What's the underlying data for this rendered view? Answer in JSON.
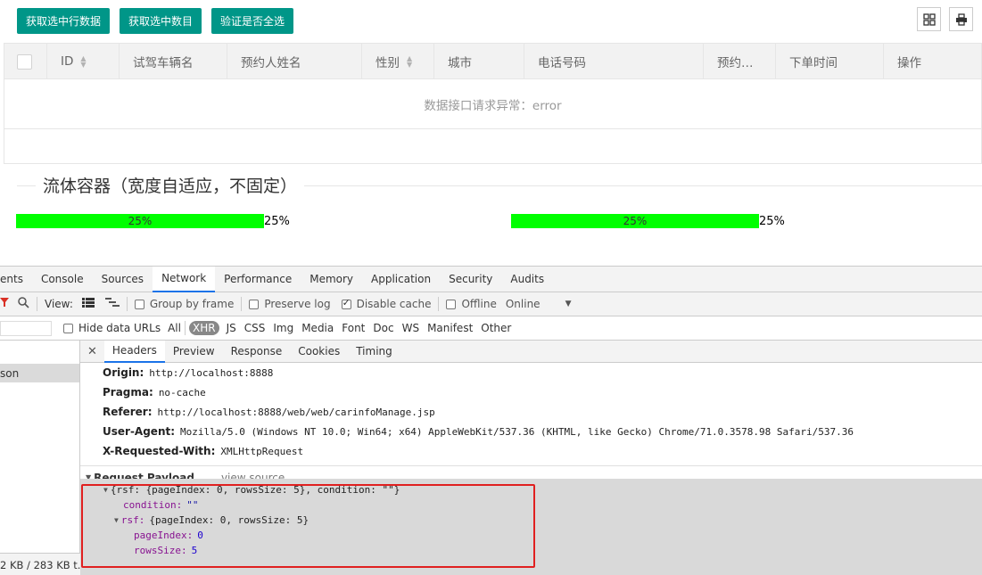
{
  "toolbar": {
    "buttons": [
      "获取选中行数据",
      "获取选中数目",
      "验证是否全选"
    ],
    "icons": [
      "grid-columns-icon",
      "print-icon"
    ]
  },
  "table": {
    "columns": [
      "ID",
      "试驾车辆名",
      "预约人姓名",
      "性别",
      "城市",
      "电话号码",
      "预约…",
      "下单时间",
      "操作"
    ],
    "empty_message": "数据接口请求异常：error"
  },
  "fieldset": {
    "legend": "流体容器（宽度自适应，不固定）"
  },
  "progress": [
    {
      "label": "25%",
      "value_text": "25%",
      "value": 0.25
    },
    {
      "label": "25%",
      "value_text": "25%",
      "value": 0.25
    }
  ],
  "colors": {
    "accent": "#009688",
    "progress_fill": "#00ff00",
    "highlight": "#e02020"
  },
  "devtools": {
    "tabs": [
      "ents",
      "Console",
      "Sources",
      "Network",
      "Performance",
      "Memory",
      "Application",
      "Security",
      "Audits"
    ],
    "active_tab": "Network",
    "bar": {
      "view_label": "View:",
      "group_by_frame": "Group by frame",
      "preserve_log": "Preserve log",
      "disable_cache": "Disable cache",
      "offline": "Offline",
      "online": "Online"
    },
    "filter": {
      "hide_data_urls": "Hide data URLs",
      "types": [
        "All",
        "XHR",
        "JS",
        "CSS",
        "Img",
        "Media",
        "Font",
        "Doc",
        "WS",
        "Manifest",
        "Other"
      ],
      "active_type": "XHR"
    },
    "request_name": "son",
    "status_text": "2 KB / 283 KB t...",
    "detail_tabs": [
      "Headers",
      "Preview",
      "Response",
      "Cookies",
      "Timing"
    ],
    "headers": [
      {
        "name": "Origin:",
        "value": "http://localhost:8888"
      },
      {
        "name": "Pragma:",
        "value": "no-cache"
      },
      {
        "name": "Referer:",
        "value": "http://localhost:8888/web/web/carinfoManage.jsp"
      },
      {
        "name": "User-Agent:",
        "value": "Mozilla/5.0 (Windows NT 10.0; Win64; x64) AppleWebKit/537.36 (KHTML, like Gecko) Chrome/71.0.3578.98 Safari/537.36"
      },
      {
        "name": "X-Requested-With:",
        "value": "XMLHttpRequest"
      }
    ],
    "payload": {
      "section_title": "Request Payload",
      "view_source": "view source",
      "summary": "{rsf: {pageIndex: 0, rowsSize: 5}, condition: \"\"}",
      "condition_key": "condition:",
      "condition_val": "\"\"",
      "rsf_summary_key": "rsf:",
      "rsf_summary": "{pageIndex: 0, rowsSize: 5}",
      "page_index_key": "pageIndex:",
      "page_index_val": "0",
      "rows_size_key": "rowsSize:",
      "rows_size_val": "5"
    }
  }
}
